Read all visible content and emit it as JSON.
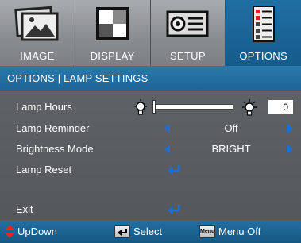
{
  "tabs": [
    {
      "label": "IMAGE",
      "icon": "image-icon",
      "active": false
    },
    {
      "label": "DISPLAY",
      "icon": "display-icon",
      "active": false
    },
    {
      "label": "SETUP",
      "icon": "projector-icon",
      "active": false
    },
    {
      "label": "OPTIONS",
      "icon": "options-list-icon",
      "active": true
    }
  ],
  "header": {
    "title": "OPTIONS | LAMP SETTINGS"
  },
  "rows": {
    "lamp_hours": {
      "label": "Lamp Hours",
      "value": "0",
      "level": 0
    },
    "lamp_reminder": {
      "label": "Lamp Reminder",
      "value": "Off"
    },
    "brightness_mode": {
      "label": "Brightness Mode",
      "value": "BRIGHT"
    },
    "lamp_reset": {
      "label": "Lamp Reset"
    },
    "exit": {
      "label": "Exit"
    }
  },
  "footer": {
    "updown": "UpDown",
    "select": "Select",
    "menu_off": "Menu Off",
    "menu_key": "Menu"
  },
  "colors": {
    "accent": "#1d6596",
    "arrow": "#1b6fd8",
    "body_bg": "#5b5e60"
  }
}
